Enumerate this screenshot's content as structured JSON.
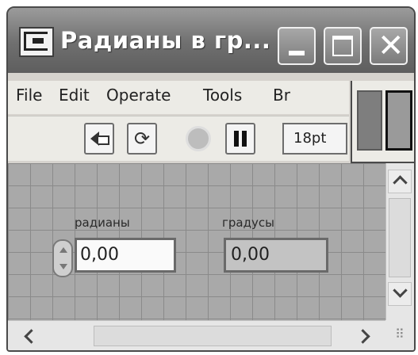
{
  "window": {
    "title": "Радианы в гр..."
  },
  "menubar": {
    "items": [
      {
        "label": "File"
      },
      {
        "label": "Edit"
      },
      {
        "label": "Operate"
      },
      {
        "label": "Tools"
      },
      {
        "label": "Br"
      }
    ]
  },
  "toolbar": {
    "font_size": "18pt",
    "run_icon": "run-arrow-icon",
    "run_continuously_icon": "run-continuously-icon",
    "abort_icon": "abort-execution-icon",
    "pause_icon": "pause-icon"
  },
  "front_panel": {
    "controls": [
      {
        "label": "радианы",
        "value": "0,00",
        "kind": "numeric-control"
      },
      {
        "label": "градусы",
        "value": "0,00",
        "kind": "numeric-indicator"
      }
    ]
  },
  "colors": {
    "titlebar": "#6f6f6f",
    "panel_background": "#a9a9a9",
    "grid_lines": "#8a8a8a"
  }
}
